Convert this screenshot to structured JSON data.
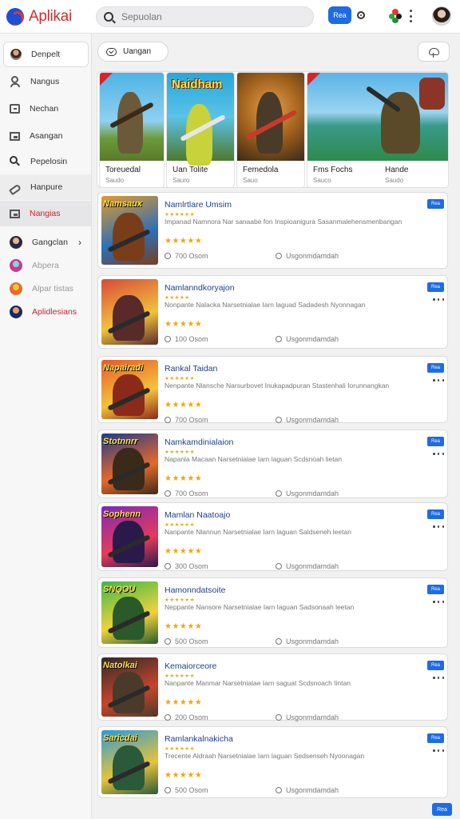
{
  "app": {
    "name": "Aplikai"
  },
  "search": {
    "placeholder": "Sepuolan"
  },
  "header": {
    "button_label": "Rea"
  },
  "sidebar": {
    "items": [
      {
        "label": "Denpelt",
        "icon": "user-avatar-icon"
      },
      {
        "label": "Nangus",
        "icon": "person-icon"
      },
      {
        "label": "Nechan",
        "icon": "inbox-icon"
      },
      {
        "label": "Asangan",
        "icon": "frame-icon"
      },
      {
        "label": "Pepelosin",
        "icon": "search-icon"
      },
      {
        "label": "Hanpure",
        "icon": "tag-icon"
      },
      {
        "label": "Nangias",
        "icon": "image-icon"
      },
      {
        "label": "Gangclan",
        "icon": "avatar-icon"
      },
      {
        "label": "Abpera",
        "icon": "avatar-icon"
      },
      {
        "label": "Alpar tistas",
        "icon": "avatar-icon"
      },
      {
        "label": "Aplidlesians",
        "icon": "avatar-icon"
      }
    ]
  },
  "filters": {
    "chip_label": "Uangan"
  },
  "featured": [
    {
      "title": "Toreuedal",
      "subtitle": "Saudo",
      "colors": [
        "#4fb3e6",
        "#6a9a3a",
        "#5a4a30"
      ]
    },
    {
      "title": "Uan Tolite",
      "subtitle": "Sauro",
      "banner": "Naidham",
      "colors": [
        "#28a7d9",
        "#e6d24a",
        "#4d7a2c"
      ]
    },
    {
      "title": "Femedola",
      "subtitle": "Sauo",
      "colors": [
        "#c8792a",
        "#7d4a1c",
        "#3a2a16"
      ]
    },
    {
      "title": "Fms Fochs",
      "subtitle": "Sauco",
      "colors": [
        "#5ab3e8",
        "#2e8a4a",
        "#7a3524"
      ]
    },
    {
      "title": "Hande",
      "subtitle": "Saudo",
      "colors": [
        "#8bbad0",
        "#3a6a2a",
        "#4a3b2a"
      ]
    }
  ],
  "list": [
    {
      "title": "Namlrtlare Umsim",
      "rating": "★★★★★★",
      "desc": "Impanad Namnora Nar sanaabe fon Inspioanigura Sasanmalehensmenbangan",
      "stars": "★★★★★",
      "size": "700 Osom",
      "updated": "Usgonmdamdah",
      "badge": "Rea",
      "thumb_word": "Namsaux",
      "thumb_colors": [
        "#e39a2a",
        "#2c6fb8",
        "#7a3d1a"
      ]
    },
    {
      "title": "Namlanndkoryajon",
      "rating": "★★★★★",
      "desc": "Nonpante Nalacka Narsetnialae Iarn laguad Sadadesh Nyonnagan",
      "stars": "★★★★★",
      "size": "100 Osom",
      "updated": "Usgonmdamdah",
      "badge": "Rea",
      "thumb_word": "",
      "thumb_colors": [
        "#d94a3a",
        "#f0c23a",
        "#5a2a2a"
      ]
    },
    {
      "title": "Rankal Taidan",
      "rating": "★★★★★★",
      "desc": "Nenpante Nlansche Narsurbovet Inukapadpuran Stastenhali Iorunnangkan",
      "stars": "★★★★★",
      "size": "700 Osom",
      "updated": "Usgonmdamdah",
      "badge": "Rea",
      "thumb_word": "Napairadi",
      "thumb_colors": [
        "#e65a2a",
        "#f5c23a",
        "#8a2a1a"
      ]
    },
    {
      "title": "Namkamdinialaion",
      "rating": "★★★★★★",
      "desc": "Napanla Macaan Narsetnialae Iarn laguan Scdsnoah lietan",
      "stars": "★★★★★",
      "size": "700 Osom",
      "updated": "Usgonmdamdah",
      "badge": "Rea",
      "thumb_word": "Stotnnrr",
      "thumb_colors": [
        "#1e3a8a",
        "#e6682a",
        "#3a2a1a"
      ]
    },
    {
      "title": "Mamlan Naatoajo",
      "rating": "★★★★★★",
      "desc": "Nanpante Nlannun Narsetnialae Iarn laguan Saldseneh leetan",
      "stars": "★★★★★",
      "size": "300 Osom",
      "updated": "Usgonmdamdah",
      "badge": "Rea",
      "thumb_word": "Sophenn",
      "thumb_colors": [
        "#7a2ab8",
        "#e63a5a",
        "#2a1a4a"
      ]
    },
    {
      "title": "Hamonndatsoite",
      "rating": "★★★★★★",
      "desc": "Neppante Nansore Narsetnialae Iarn laguan Sadsonaah leetan",
      "stars": "★★★★★",
      "size": "500 Osom",
      "updated": "Usgonmdamdah",
      "badge": "Rea",
      "thumb_word": "SNQOU",
      "thumb_colors": [
        "#3ab84a",
        "#f0d23a",
        "#2a5a2a"
      ]
    },
    {
      "title": "Kemaiorceore",
      "rating": "★★★★★★",
      "desc": "Nanpante Manmar Narsetnialae Iarn saguat Scdsnoach Iintan",
      "stars": "★★★★★",
      "size": "200 Osom",
      "updated": "Usgonmdamdah",
      "badge": "Rea",
      "thumb_word": "Natolkai",
      "thumb_colors": [
        "#2a2a2a",
        "#c8442a",
        "#4a3a2a"
      ]
    },
    {
      "title": "Ramlankalnakicha",
      "rating": "★★★★★★",
      "desc": "Trecente Aldraah Narsetnialae Iarn laguan Sedsenseh Nyoonagan",
      "stars": "★★★★★",
      "size": "500 Osom",
      "updated": "Usgonmdamdah",
      "badge": "Rea",
      "thumb_word": "Saricdai",
      "thumb_colors": [
        "#2a9ad8",
        "#e6c23a",
        "#2a5a3a"
      ]
    }
  ],
  "footer": {
    "badge": "Rea"
  },
  "colors": {
    "accent": "#1e6be6",
    "brand": "#d52b2b",
    "title": "#1e3f8f",
    "star": "#f2a60f"
  }
}
